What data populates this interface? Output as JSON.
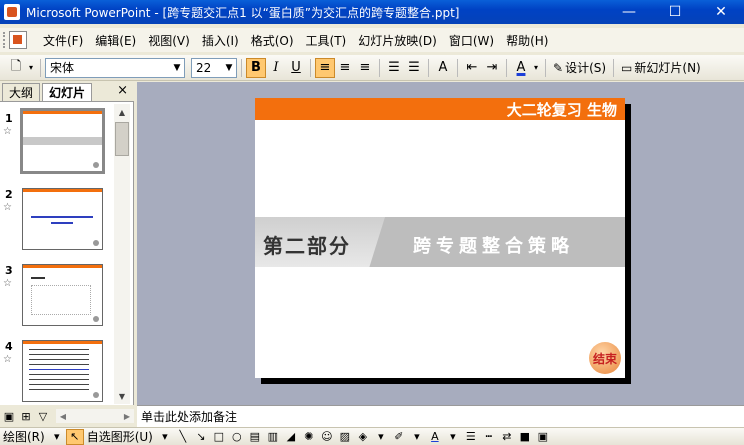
{
  "window": {
    "title": "Microsoft PowerPoint - [跨专题交汇点1   以“蛋白质”为交汇点的跨专题整合.ppt]",
    "controls": {
      "minimize": "—",
      "maximize": "☐",
      "close": "✕"
    }
  },
  "menubar": {
    "items": [
      "文件(F)",
      "编辑(E)",
      "视图(V)",
      "插入(I)",
      "格式(O)",
      "工具(T)",
      "幻灯片放映(D)",
      "窗口(W)",
      "帮助(H)"
    ]
  },
  "toolbar": {
    "font_name": "宋体",
    "font_size": "22",
    "bold": "B",
    "italic": "I",
    "underline": "U",
    "design_label": "设计(S)",
    "new_slide_label": "新幻灯片(N)",
    "font_color_label": "A"
  },
  "left_pane": {
    "tabs": [
      "大纲",
      "幻灯片"
    ],
    "active_tab": "幻灯片",
    "close": "×",
    "slide_numbers": [
      "1",
      "2",
      "3",
      "4"
    ],
    "star": "☆"
  },
  "slide": {
    "header": "大二轮复习  生物",
    "part": "第二部分",
    "strategy": "跨专题整合策略",
    "end_button": "结束",
    "colors": {
      "header": "#f36f0d",
      "band": "#bdbdbd"
    }
  },
  "notes": {
    "placeholder": "单击此处添加备注"
  },
  "drawbar": {
    "draw_label": "绘图(R)",
    "autoshape_label": "自选图形(U)"
  }
}
